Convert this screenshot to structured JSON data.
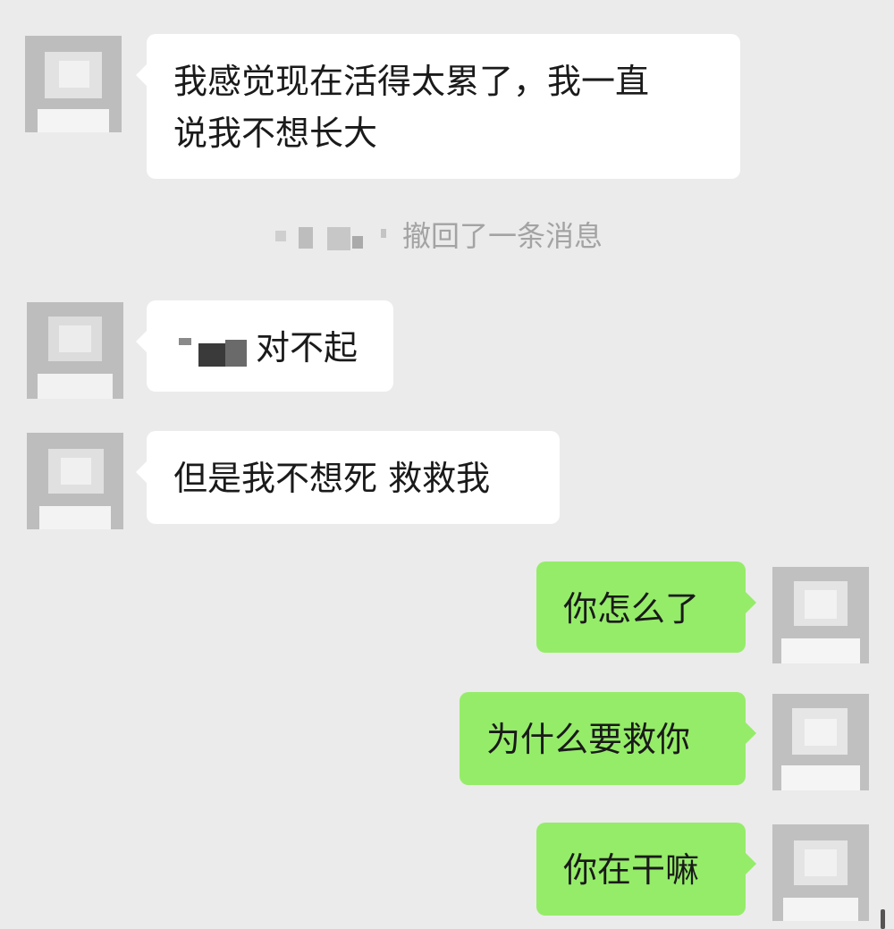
{
  "conversation": {
    "messages": [
      {
        "text_lines": [
          "我感觉现在活得太累了，我一直",
          "说我不想长大"
        ]
      },
      {
        "recalled_notice": "撤回了一条消息"
      },
      {
        "text": "对不起"
      },
      {
        "text": "但是我不想死 救救我"
      },
      {
        "text": "你怎么了"
      },
      {
        "text": "为什么要救你"
      },
      {
        "text": "你在干嘛"
      }
    ]
  },
  "colors": {
    "background": "#ebebeb",
    "incoming_bubble": "#ffffff",
    "outgoing_bubble": "#95ec69",
    "system_text": "#a3a3a3",
    "avatar_mosaic": "#c2c2c2"
  },
  "avatar_icon": "pixelated-avatar-icon"
}
